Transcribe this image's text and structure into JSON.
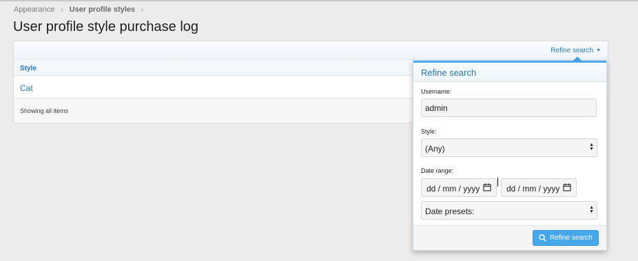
{
  "breadcrumb": [
    "Appearance",
    "User profile styles"
  ],
  "breadcrumb_separator": "›",
  "page_title": "User profile style purchase log",
  "table": {
    "refine_toggle_label": "Refine search",
    "column_header": "Style",
    "rows": [
      "Cat"
    ],
    "footer_text": "Showing all items"
  },
  "refine_menu": {
    "title": "Refine search",
    "username_label": "Username:",
    "username_value": "admin",
    "style_label": "Style:",
    "style_value": "(Any)",
    "date_range_label": "Date range:",
    "date_start_placeholder": "dd / mm / yyyy",
    "date_end_placeholder": "dd / mm / yyyy",
    "date_presets_value": "Date presets:",
    "submit_label": "Refine search"
  },
  "colors": {
    "accent": "#2577b1",
    "button": "#47a7eb",
    "background": "#ececec"
  }
}
